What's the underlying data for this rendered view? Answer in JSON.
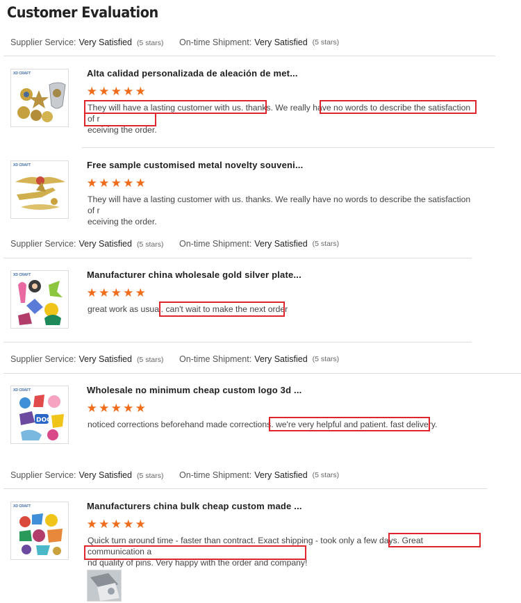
{
  "page": {
    "title": "Customer Evaluation"
  },
  "labels": {
    "supplier_service": "Supplier Service:",
    "ontime_shipment": "On-time Shipment:",
    "very_satisfied": "Very Satisfied",
    "five_stars": "(5 stars)"
  },
  "reviews": [
    {
      "product": "Alta calidad personalizada de aleación de met...",
      "rating": 5,
      "text": "They will have a lasting customer with us. thanks. We really have no words to describe the satisfaction of receiving the order.",
      "text_line1": "They will have a lasting customer with us. thanks. We really have no words to describe the satisfaction of r",
      "text_line2": "eceiving the order."
    },
    {
      "product": "Free sample customised metal novelty souveni...",
      "rating": 5,
      "text_line1": "They will have a lasting customer with us. thanks. We really have no words to describe the satisfaction of r",
      "text_line2": "eceiving the order."
    },
    {
      "product": "Manufacturer china wholesale gold silver plate...",
      "rating": 5,
      "text_line1": "great work as usual. can't wait to make the next order"
    },
    {
      "product": "Wholesale no minimum cheap custom logo 3d ...",
      "rating": 5,
      "text_line1": "noticed corrections beforehand made corrections. we're very helpful and patient. fast delivery."
    },
    {
      "product": "Manufacturers china bulk cheap custom made ...",
      "rating": 5,
      "text_line1": "Quick turn around time - faster than contract. Exact shipping - took only a few days. Great communication a",
      "text_line2": "nd quality of pins. Very happy with the order and company!"
    }
  ],
  "colors": {
    "star": "#f06c1b",
    "highlight_box": "#e0242c",
    "divider": "#dddddd"
  },
  "icons": {
    "star": "star-icon",
    "brand_logo": "xd-craft-logo"
  }
}
